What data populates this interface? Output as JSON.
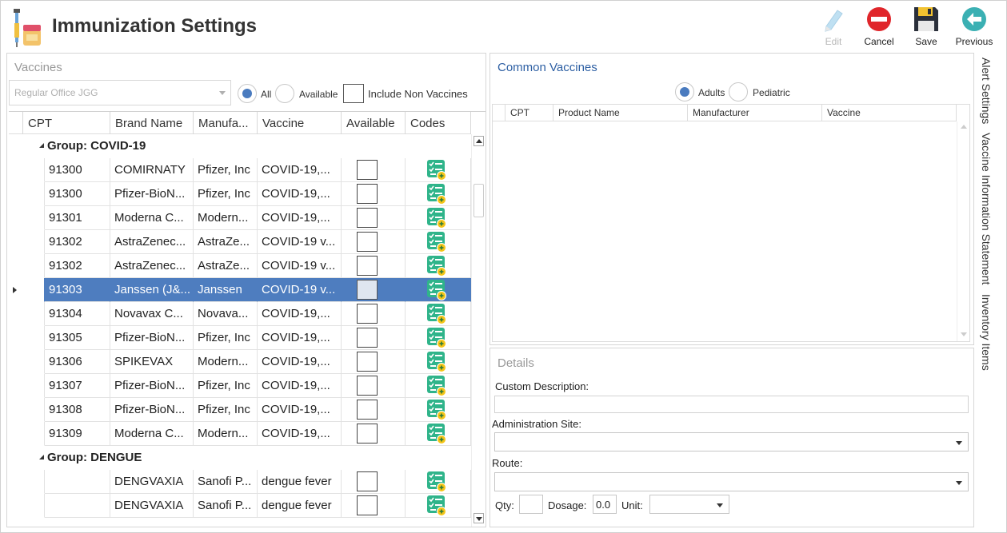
{
  "window": {
    "title": "Immunization Settings"
  },
  "toolbar": {
    "edit_label": "Edit",
    "cancel_label": "Cancel",
    "save_label": "Save",
    "previous_label": "Previous"
  },
  "vaccines_panel": {
    "title": "Vaccines",
    "office_select_value": "Regular Office JGG",
    "radio_all": "All",
    "radio_available": "Available",
    "include_non_vaccines": "Include Non Vaccines",
    "columns": [
      "CPT",
      "Brand Name",
      "Manufa...",
      "Vaccine",
      "Available",
      "Codes"
    ],
    "groups": [
      {
        "label": "Group: COVID-19",
        "rows": [
          {
            "cpt": "91300",
            "brand": "COMIRNATY",
            "manufacturer": "Pfizer, Inc",
            "vaccine": "COVID-19,...",
            "available": false,
            "selected": false
          },
          {
            "cpt": "91300",
            "brand": "Pfizer-BioN...",
            "manufacturer": "Pfizer, Inc",
            "vaccine": "COVID-19,...",
            "available": false,
            "selected": false
          },
          {
            "cpt": "91301",
            "brand": "Moderna C...",
            "manufacturer": "Modern...",
            "vaccine": "COVID-19,...",
            "available": false,
            "selected": false
          },
          {
            "cpt": "91302",
            "brand": "AstraZenec...",
            "manufacturer": "AstraZe...",
            "vaccine": "COVID-19 v...",
            "available": false,
            "selected": false
          },
          {
            "cpt": "91302",
            "brand": "AstraZenec...",
            "manufacturer": "AstraZe...",
            "vaccine": "COVID-19 v...",
            "available": false,
            "selected": false
          },
          {
            "cpt": "91303",
            "brand": "Janssen (J&...",
            "manufacturer": "Janssen",
            "vaccine": "COVID-19 v...",
            "available": false,
            "selected": true
          },
          {
            "cpt": "91304",
            "brand": "Novavax C...",
            "manufacturer": "Novava...",
            "vaccine": "COVID-19,...",
            "available": false,
            "selected": false
          },
          {
            "cpt": "91305",
            "brand": "Pfizer-BioN...",
            "manufacturer": "Pfizer, Inc",
            "vaccine": "COVID-19,...",
            "available": false,
            "selected": false
          },
          {
            "cpt": "91306",
            "brand": "SPIKEVAX",
            "manufacturer": "Modern...",
            "vaccine": "COVID-19,...",
            "available": false,
            "selected": false
          },
          {
            "cpt": "91307",
            "brand": "Pfizer-BioN...",
            "manufacturer": "Pfizer, Inc",
            "vaccine": "COVID-19,...",
            "available": false,
            "selected": false
          },
          {
            "cpt": "91308",
            "brand": "Pfizer-BioN...",
            "manufacturer": "Pfizer, Inc",
            "vaccine": "COVID-19,...",
            "available": false,
            "selected": false
          },
          {
            "cpt": "91309",
            "brand": "Moderna C...",
            "manufacturer": "Modern...",
            "vaccine": "COVID-19,...",
            "available": false,
            "selected": false
          }
        ]
      },
      {
        "label": "Group: DENGUE",
        "rows": [
          {
            "cpt": "",
            "brand": "DENGVAXIA",
            "manufacturer": "Sanofi P...",
            "vaccine": "dengue fever",
            "available": false,
            "selected": false
          },
          {
            "cpt": "",
            "brand": "DENGVAXIA",
            "manufacturer": "Sanofi P...",
            "vaccine": "dengue fever",
            "available": false,
            "selected": false
          }
        ]
      }
    ]
  },
  "common_vaccines": {
    "title": "Common Vaccines",
    "radio_adults": "Adults",
    "radio_pediatric": "Pediatric",
    "columns": [
      "CPT",
      "Product Name",
      "Manufacturer",
      "Vaccine"
    ]
  },
  "details": {
    "title": "Details",
    "custom_description_label": "Custom Description:",
    "custom_description_value": "",
    "administration_site_label": "Administration Site:",
    "route_label": "Route:",
    "qty_label": "Qty:",
    "qty_value": "",
    "dosage_label": "Dosage:",
    "dosage_value": "0.0",
    "unit_label": "Unit:"
  },
  "side_tabs": [
    "Alert Settings",
    "Vaccine Information Statement",
    "Inventory Items"
  ],
  "colors": {
    "selection": "#4e7dbf",
    "accent_title": "#2d5fa3",
    "cancel_red": "#e0262b",
    "previous_teal": "#3bb0b3",
    "codes_green": "#2fb48a"
  }
}
